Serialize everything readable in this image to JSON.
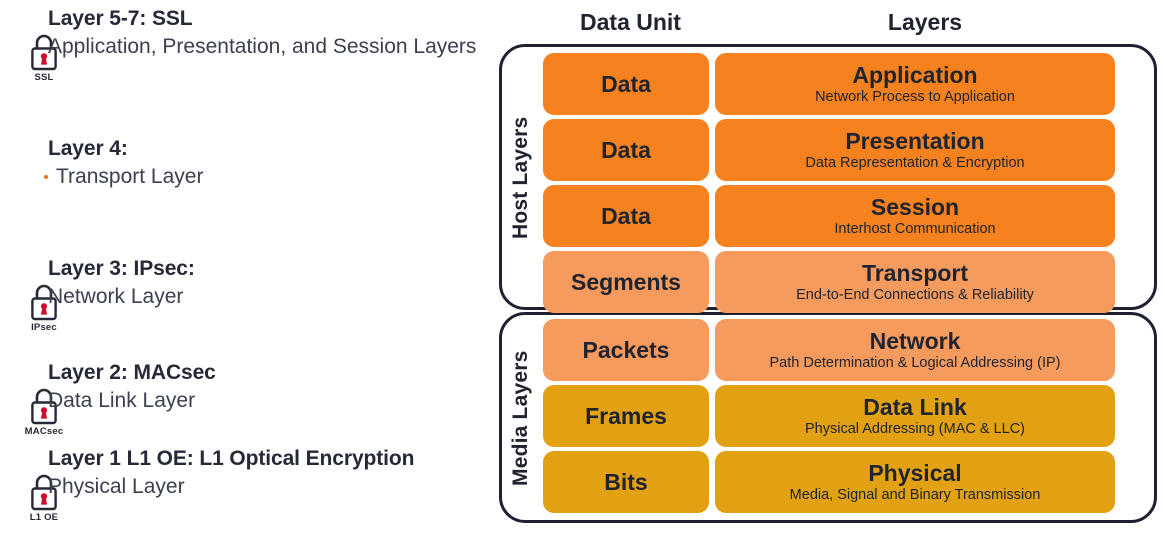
{
  "left_panel": {
    "sections": [
      {
        "id": "ssl",
        "title": "Layer 5-7: SSL",
        "body": "Application, Presentation, and Session Layers",
        "icon_label": "SSL",
        "icon_name": "padlock-icon-ssl",
        "has_icon": true,
        "has_bullet": false
      },
      {
        "id": "transport",
        "title": "Layer 4:",
        "body": "Transport Layer",
        "icon_label": "",
        "icon_name": "",
        "has_icon": false,
        "has_bullet": true
      },
      {
        "id": "ipsec",
        "title": "Layer 3: IPsec:",
        "body": "Network Layer",
        "icon_label": "IPsec",
        "icon_name": "padlock-icon-ipsec",
        "has_icon": true,
        "has_bullet": false
      },
      {
        "id": "macsec",
        "title": "Layer 2: MACsec",
        "body": "Data Link Layer",
        "icon_label": "MACsec",
        "icon_name": "padlock-icon-macsec",
        "has_icon": true,
        "has_bullet": false
      },
      {
        "id": "l1oe",
        "title": "Layer 1 L1 OE: L1 Optical Encryption",
        "body": "Physical Layer",
        "icon_label": "L1 OE",
        "icon_name": "padlock-icon-l1oe",
        "has_icon": true,
        "has_bullet": false
      }
    ]
  },
  "diagram": {
    "headers": {
      "data_unit": "Data Unit",
      "layers": "Layers"
    },
    "groups": [
      {
        "id": "host",
        "label": "Host Layers"
      },
      {
        "id": "media",
        "label": "Media Layers"
      }
    ],
    "rows": [
      {
        "group": "host",
        "unit": "Data",
        "layer": "Application",
        "description": "Network Process to Application",
        "color": "#F5821F"
      },
      {
        "group": "host",
        "unit": "Data",
        "layer": "Presentation",
        "description": "Data Representation & Encryption",
        "color": "#F5821F"
      },
      {
        "group": "host",
        "unit": "Data",
        "layer": "Session",
        "description": "Interhost Communication",
        "color": "#F5821F"
      },
      {
        "group": "host",
        "unit": "Segments",
        "layer": "Transport",
        "description": "End-to-End Connections & Reliability",
        "color": "#F59B5E"
      },
      {
        "group": "media",
        "unit": "Packets",
        "layer": "Network",
        "description": "Path Determination & Logical Addressing (IP)",
        "color": "#F59B5E"
      },
      {
        "group": "media",
        "unit": "Frames",
        "layer": "Data Link",
        "description": "Physical Addressing (MAC & LLC)",
        "color": "#E2A113"
      },
      {
        "group": "media",
        "unit": "Bits",
        "layer": "Physical",
        "description": "Media, Signal and Binary Transmission",
        "color": "#E2A113"
      }
    ]
  },
  "colors": {
    "dark_orange": "#F5821F",
    "light_orange": "#F59B5E",
    "gold": "#E2A113",
    "outline": "#1C2030",
    "lock_red": "#CE0E2D",
    "text_dark": "#262A37"
  }
}
